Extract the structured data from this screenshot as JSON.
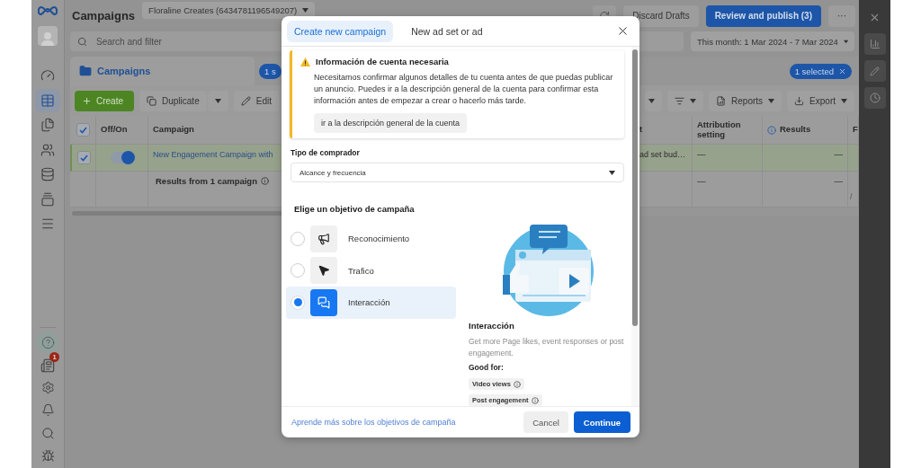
{
  "top_bar": {
    "title": "Campaigns",
    "account": "Floraline Creates (6434781196549207)",
    "buttons": [
      {
        "kind": "secondary",
        "label": "Discard Drafts"
      },
      {
        "kind": "primary",
        "label": "Review and publish (3)"
      },
      {
        "kind": "more",
        "label": "···"
      }
    ]
  },
  "nav": {
    "items": [
      {
        "selected": false
      },
      {
        "selected": true
      },
      {
        "selected": false
      },
      {
        "selected": false
      },
      {
        "selected": false
      },
      {
        "selected": false
      },
      {
        "selected": false
      }
    ],
    "notification_count": "1"
  },
  "search": {
    "placeholder": "Search and filter"
  },
  "date_range": "This month: 1 Mar 2024 - 7 Mar 2024",
  "campaigns_tab": {
    "label": "Campaigns",
    "count_badge": "1 s",
    "selection_chip": "1 selected"
  },
  "toolbar": {
    "create": "Create",
    "duplicate": "Duplicate",
    "edit": "Edit",
    "reports": "Reports",
    "export": "Export"
  },
  "table": {
    "all_checked": true,
    "columns": [
      {
        "label": "Off/On",
        "info": false
      },
      {
        "label": "Campaign",
        "info": false
      },
      {
        "label": "t",
        "info": false
      },
      {
        "label": "Attribution setting",
        "info": false
      },
      {
        "label": "Results",
        "info": true
      },
      {
        "label": "F",
        "info": false
      }
    ],
    "rows": [
      {
        "checked": true,
        "on": true,
        "campaign": "New Engagement Campaign with",
        "column_3": "ad set bud…",
        "attribution": "—",
        "results": "—"
      }
    ],
    "summary": {
      "label": "Results from 1 campaign",
      "attribution": "—",
      "results": "—",
      "column_6": "/"
    }
  },
  "modal": {
    "tabs": [
      {
        "label": "Create new campaign",
        "selected": true
      },
      {
        "label": "New ad set or ad",
        "selected": false
      }
    ],
    "notice": {
      "title": "Información de cuenta necesaria",
      "body": "Necesitamos confirmar algunos detalles de tu cuenta antes de que puedas publicar un anuncio. Puedes ir a la descripción general de la cuenta para confirmar esta información antes de empezar a crear o hacerlo más tarde.",
      "action": "ir a la descripción general de la cuenta"
    },
    "buyer_type": {
      "label": "Tipo de comprador",
      "value": "Alcance y frecuencia"
    },
    "objective_heading": "Elige un objetivo de campaña",
    "objectives": [
      {
        "label": "Reconocimiento",
        "selected": false
      },
      {
        "label": "Trafico",
        "selected": false
      },
      {
        "label": "Interacción",
        "selected": true
      }
    ],
    "detail": {
      "title": "Interacción",
      "description": "Get more Page likes, event responses or post engagement.",
      "good_for_label": "Good for:",
      "good_for": [
        "Video views",
        "Post engagement"
      ]
    },
    "footer": {
      "link": "Aprende más sobre los objetivos de campaña",
      "cancel": "Cancel",
      "continue": "Continue"
    }
  }
}
